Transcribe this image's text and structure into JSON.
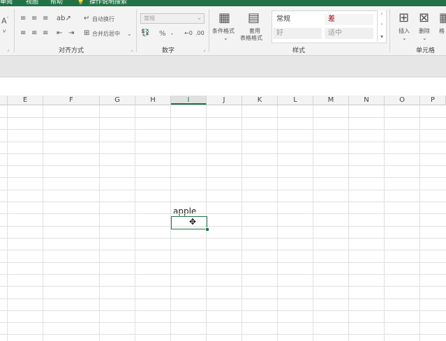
{
  "menu": {
    "items": [
      "审阅",
      "视图",
      "帮助",
      "操作说明搜索"
    ]
  },
  "ribbon": {
    "alignment": {
      "label": "对齐方式",
      "wrap_text": "自动换行",
      "merge_center": "合并后居中"
    },
    "number": {
      "label": "数字",
      "format_value": "常规",
      "percent": "%",
      "comma": ","
    },
    "styles": {
      "label": "样式",
      "conditional_format": "条件格式",
      "format_table_line1": "套用",
      "format_table_line2": "表格格式",
      "cell_styles": {
        "normal": "常规",
        "bad": "差",
        "good": "好",
        "neutral": "适中"
      }
    },
    "cells": {
      "label": "单元格",
      "insert": "插入",
      "delete": "删除",
      "format_partial": "格"
    },
    "left_partial": {
      "a_glyph": "A"
    }
  },
  "columns": [
    "E",
    "F",
    "G",
    "H",
    "I",
    "J",
    "K",
    "L",
    "M",
    "N",
    "O",
    "P"
  ],
  "active_column": "I",
  "cells": {
    "apple": "apple"
  },
  "colors": {
    "accent": "#217346",
    "grid_line": "#e0e0e0",
    "bad_fill": "#ffc7ce",
    "good_fill": "#c6efce",
    "neutral_fill": "#ffeb9c"
  },
  "icons": {
    "cursor": "plus-cross-cursor-icon"
  }
}
